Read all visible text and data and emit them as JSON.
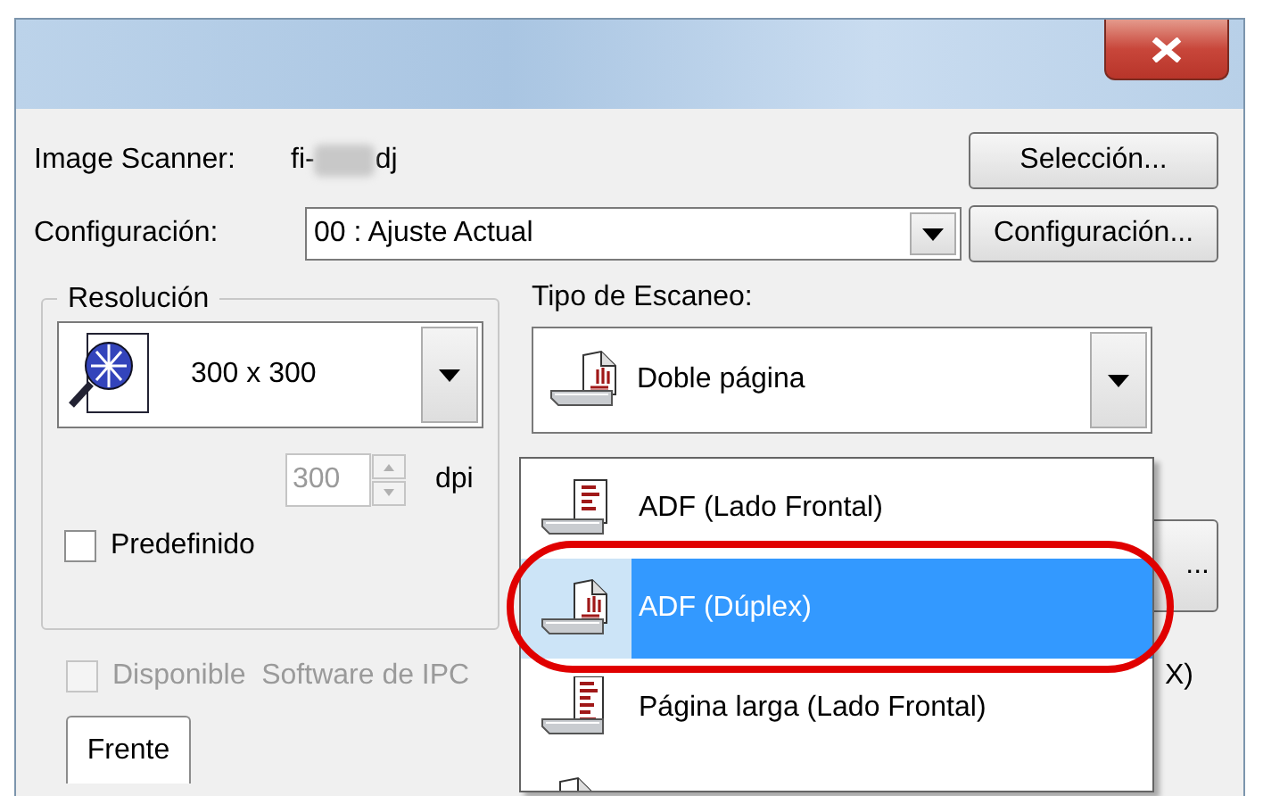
{
  "scanner": {
    "label": "Image Scanner:",
    "model_prefix": "fi-",
    "model_suffix": "dj",
    "button": "Selección..."
  },
  "configuration": {
    "label": "Configuración:",
    "value": "00 : Ajuste Actual",
    "button": "Configuración..."
  },
  "resolution": {
    "title": "Resolución",
    "value": "300 x 300",
    "dpi_value": "300",
    "dpi_disabled": true,
    "dpi_unit": "dpi",
    "default_checkbox": {
      "label": "Predefinido",
      "checked": false
    }
  },
  "scan_type": {
    "label": "Tipo de Escaneo:",
    "value": "Doble página",
    "options": [
      {
        "kind": "front",
        "label": "ADF (Lado Frontal)",
        "selected": false
      },
      {
        "kind": "duplex",
        "label": "ADF (Dúplex)",
        "selected": true
      },
      {
        "kind": "long",
        "label": "Página larga (Lado Frontal)",
        "selected": false
      },
      {
        "kind": "duplex",
        "selected": false
      }
    ]
  },
  "hidden_button": "...",
  "ipc_checkbox": {
    "label": "Disponible  Software de IPC",
    "checked": false,
    "disabled": true
  },
  "trailing_text": "X)",
  "tabs": [
    {
      "label": "Frente",
      "selected": true
    }
  ]
}
